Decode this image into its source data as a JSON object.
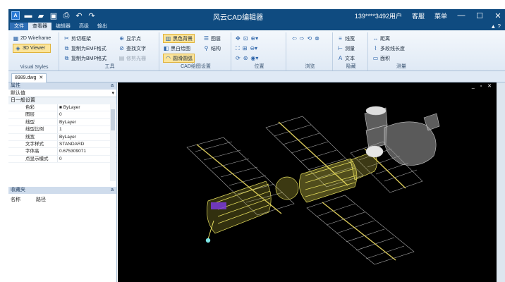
{
  "window": {
    "title": "风云CAD编辑器",
    "user": "139****3492用户",
    "service": "客服",
    "menu": "菜单",
    "minimize": "—",
    "maximize": "☐",
    "close": "✕"
  },
  "quick_access": [
    "new-icon",
    "open-icon",
    "save-icon",
    "print-icon",
    "undo-icon",
    "redo-icon"
  ],
  "tabs": [
    {
      "label": "文件"
    },
    {
      "label": "查看器"
    },
    {
      "label": "编辑器"
    },
    {
      "label": "高级"
    },
    {
      "label": "输出"
    }
  ],
  "tab_right": "▲ ?",
  "ribbon": {
    "visual_styles": {
      "label": "Visual Styles",
      "wireframe": "2D Wireframe",
      "viewer": "3D Viewer"
    },
    "tools": {
      "label": "工具",
      "clip": "剪切框架",
      "copy_emf": "复制为EMF格式",
      "copy_bmp": "复制为BMP格式",
      "show_points": "显示点",
      "find_text": "查找文字",
      "trim_light": "修剪光栅"
    },
    "cad_settings": {
      "label": "CAD绘图设置",
      "black_bg": "黑色背景",
      "bw_draw": "黑白绘图",
      "smooth": "圆滑圆弧",
      "layers": "图层",
      "structure": "结构"
    },
    "position": {
      "label": "位置"
    },
    "browse": {
      "label": "浏览"
    },
    "hidden": {
      "label": "隐藏",
      "line_width": "线宽",
      "measure": "测量",
      "text": "文本"
    },
    "measure": {
      "label": "测量",
      "distance": "距离",
      "polyline_length": "多段线长度",
      "area": "面积"
    }
  },
  "document": {
    "tab": "8989.dwg",
    "close": "✕"
  },
  "properties": {
    "header": "属性",
    "pin": "a",
    "default": "默认值",
    "category": "日一般设置",
    "rows": [
      {
        "key": "色彩",
        "value": "■ ByLayer"
      },
      {
        "key": "图层",
        "value": "0"
      },
      {
        "key": "线型",
        "value": "ByLayer"
      },
      {
        "key": "线型比例",
        "value": "1"
      },
      {
        "key": "线宽",
        "value": "ByLayer"
      },
      {
        "key": "文字样式",
        "value": "STANDARD"
      },
      {
        "key": "字体高",
        "value": "0.675309071"
      },
      {
        "key": "点显示模式",
        "value": "0"
      }
    ]
  },
  "favorites": {
    "header": "收藏夹",
    "pin": "a",
    "col_name": "名称",
    "col_path": "路径"
  },
  "canvas": {
    "controls": "_ ▫ ✕"
  }
}
